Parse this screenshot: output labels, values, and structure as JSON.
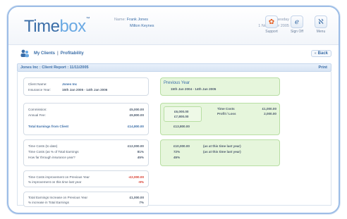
{
  "app": {
    "logo_part1": "Time",
    "logo_part2": "box",
    "tm": "™"
  },
  "header": {
    "name_label": "Name:",
    "user_name": "Frank Jones",
    "company": "Milton Keynes",
    "day": "Tuesday",
    "date": "1 November 2005"
  },
  "toolbar": {
    "support_label": "Support",
    "signoff_label": "Sign Off",
    "menu_label": "Menu"
  },
  "nav": {
    "my_clients": "My Clients",
    "separator": "|",
    "profitability": "Profitability",
    "back": "Back"
  },
  "report": {
    "title": "Jones Inc : Client Report : 11/11/2005",
    "print": "Print"
  },
  "client": {
    "name_label": "Client Name:",
    "name_value": "Jones Inc",
    "insurance_label": "Insurance Year:",
    "insurance_value": "15th Jan 2005 - 14th Jan 2006"
  },
  "earnings": {
    "commission_label": "Commission:",
    "commission_value": "£5,000.00",
    "annual_fee_label": "Annual Fee:",
    "annual_fee_value": "£9,800.00",
    "total_label": "Total Earnings from Client",
    "total_value": "£14,800.00"
  },
  "time_costs": {
    "to_date_label": "Time Costs (to date)",
    "to_date_value": "£12,000.00",
    "pct_label": "Time Costs (as % of Total Earnings",
    "pct_value": "81%",
    "how_far_label": "How far through insurance year?",
    "how_far_value": "45%"
  },
  "improvement": {
    "prev_label": "Time Costs improvement on Previous Year",
    "prev_value": "-£2,000.00",
    "pct_label": "% improvement on this time last year",
    "pct_value": "-9%"
  },
  "earnings_increase": {
    "total_label": "Total Earnings Increase on Previous Year",
    "total_value": "£1,000.00",
    "pct_label": "% increase in Total Earnings",
    "pct_value": "7%"
  },
  "previous_year": {
    "title": "Previous Year",
    "dates": "15th Jan 2004 - 14th Jan 2005",
    "commission": "£6,000.00",
    "annual_fee": "£7,800.00",
    "time_costs_label": "Time Costs",
    "time_costs_value": "£1,000.00",
    "profit_label": "Profit / Loss",
    "profit_value": "2,000.00",
    "total": "£13,800.00",
    "tc_value": "£10,000.00",
    "tc_note": "(as at this time last year)",
    "pct_value": "72%",
    "pct_note": "(as at this time last year)",
    "how_far_value": "45%"
  },
  "colors": {
    "accent": "#3b6ea8",
    "negative": "#d83b2e",
    "green_panel": "#e6f6dc"
  }
}
